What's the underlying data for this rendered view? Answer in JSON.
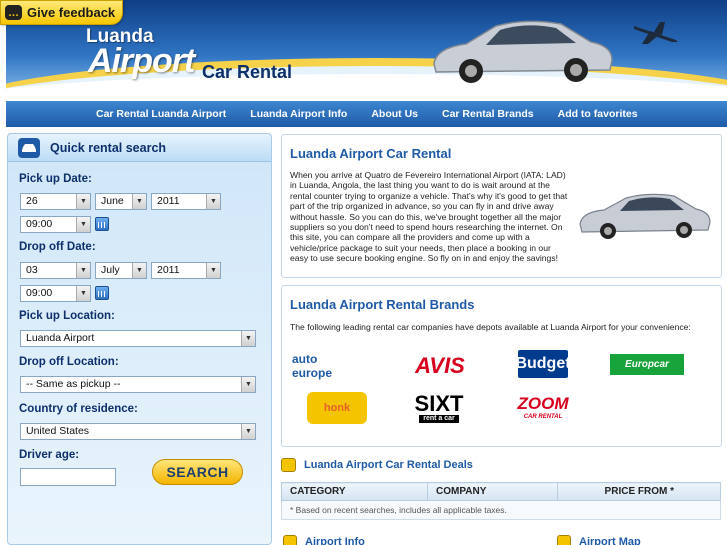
{
  "feedback": {
    "label": "Give feedback",
    "icon": "speech-bubble-icon"
  },
  "logo": {
    "line1": "Luanda",
    "line2": "Airport",
    "line3": "Car Rental"
  },
  "nav": [
    "Car Rental Luanda Airport",
    "Luanda Airport Info",
    "About Us",
    "Car Rental Brands",
    "Add to favorites"
  ],
  "search": {
    "title": "Quick rental search",
    "pickup_date_label": "Pick up Date:",
    "pickup_day": "26",
    "pickup_month": "June",
    "pickup_year": "2011",
    "pickup_time": "09:00",
    "dropoff_date_label": "Drop off Date:",
    "dropoff_day": "03",
    "dropoff_month": "July",
    "dropoff_year": "2011",
    "dropoff_time": "09:00",
    "pickup_location_label": "Pick up Location:",
    "pickup_location": "Luanda Airport",
    "dropoff_location_label": "Drop off Location:",
    "dropoff_location": "-- Same as pickup --",
    "country_label": "Country of residence:",
    "country": "United States",
    "age_label": "Driver age:",
    "age": "",
    "button": "SEARCH"
  },
  "intro": {
    "title": "Luanda Airport Car Rental",
    "text": "When you arrive at Quatro de Fevereiro International Airport (IATA: LAD) in Luanda, Angola, the last thing you want to do is wait around at the rental counter trying to organize a vehicle. That's why it's good to get that part of the trip organized in advance, so you can fly in and drive away without hassle. So you can do this, we've brought together all the major suppliers so you don't need to spend hours researching the internet. On this site, you can compare all the providers and come up with a vehicle/price package to suit your needs, then place a booking in our easy to use secure booking engine. So fly on in and enjoy the savings!"
  },
  "brands": {
    "title": "Luanda Airport Rental Brands",
    "text": "The following leading rental car companies have depots available at Luanda Airport for your convenience:",
    "items": [
      {
        "name": "auto europe",
        "color": "#1f5aa6"
      },
      {
        "name": "AVIS",
        "color": "#d7001c"
      },
      {
        "name": "Budget",
        "color": "#003b8e"
      },
      {
        "name": "Europcar",
        "color": "#19a33b"
      },
      {
        "name": "honk",
        "color": "#e8612a"
      },
      {
        "name": "SIXT",
        "sub": "rent a car",
        "color": "#000000"
      },
      {
        "name": "ZOOM",
        "sub": "CAR RENTAL",
        "color": "#d7001c"
      }
    ]
  },
  "deals": {
    "title": "Luanda Airport Car Rental Deals",
    "columns": [
      "CATEGORY",
      "COMPANY",
      "PRICE FROM *"
    ],
    "footnote": "* Based on recent searches, includes all applicable taxes."
  },
  "footer_links": {
    "info": "Airport Info",
    "map": "Airport Map"
  }
}
